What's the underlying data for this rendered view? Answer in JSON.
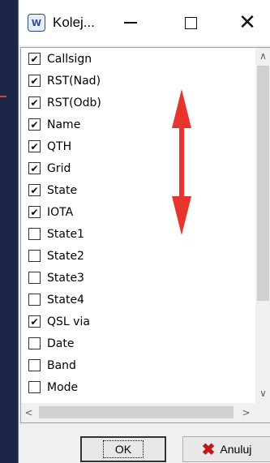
{
  "window": {
    "title": "Kolej...",
    "icon_text": "W"
  },
  "titlebar_buttons": {
    "minimize": "minimize",
    "maximize": "maximize",
    "close": "✕"
  },
  "items": [
    {
      "label": "Callsign",
      "checked": true
    },
    {
      "label": "RST(Nad)",
      "checked": true
    },
    {
      "label": "RST(Odb)",
      "checked": true
    },
    {
      "label": "Name",
      "checked": true
    },
    {
      "label": "QTH",
      "checked": true
    },
    {
      "label": "Grid",
      "checked": true
    },
    {
      "label": "State",
      "checked": true
    },
    {
      "label": "IOTA",
      "checked": true
    },
    {
      "label": "State1",
      "checked": false
    },
    {
      "label": "State2",
      "checked": false
    },
    {
      "label": "State3",
      "checked": false
    },
    {
      "label": "State4",
      "checked": false
    },
    {
      "label": "QSL via",
      "checked": true
    },
    {
      "label": "Date",
      "checked": false
    },
    {
      "label": "Band",
      "checked": false
    },
    {
      "label": "Mode",
      "checked": false
    }
  ],
  "buttons": {
    "ok": "OK",
    "cancel": "Anuluj"
  },
  "colors": {
    "annotation_arrow": "#e8342f",
    "cancel_icon": "#c0161c"
  }
}
